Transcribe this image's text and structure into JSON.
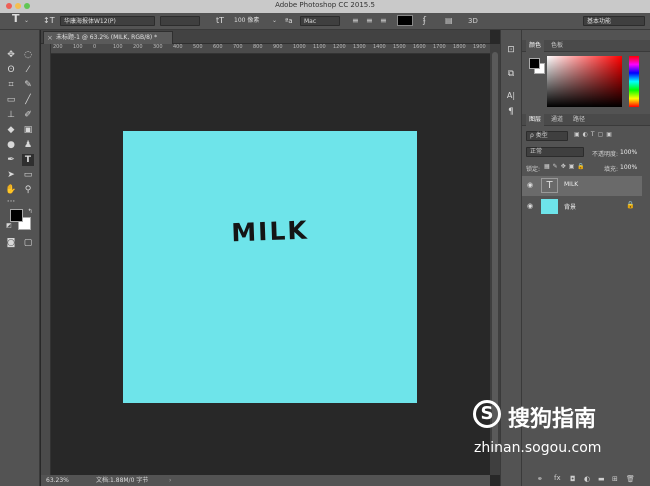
{
  "window": {
    "title": "Adobe Photoshop CC 2015.5"
  },
  "options_bar": {
    "font_family": "华康海报体W12(P)",
    "font_size": "100 像素",
    "antialias": "Mac",
    "workspace": "基本功能"
  },
  "document": {
    "tab_label": "未标题-1 @ 63.2% (MILK, RGB/8) *"
  },
  "ruler": {
    "labels": [
      "200",
      "100",
      "0",
      "100",
      "200",
      "300",
      "400",
      "500",
      "600",
      "700",
      "800",
      "900",
      "1000",
      "1100",
      "1200",
      "1300",
      "1400",
      "1500",
      "1600",
      "1700",
      "1800",
      "1900"
    ]
  },
  "canvas": {
    "text": "MILK",
    "fill_color": "#6ee4ea"
  },
  "status": {
    "zoom": "63.23%",
    "doc_info": "文档:1.88M/0 字节"
  },
  "color_panel": {
    "tabs": [
      "颜色",
      "色板"
    ]
  },
  "layers_panel": {
    "tabs": [
      "图层",
      "通道",
      "路径"
    ],
    "filter_label": "ρ 类型",
    "blend_mode": "正常",
    "opacity_label": "不透明度:",
    "opacity_value": "100%",
    "lock_label": "锁定:",
    "fill_label": "填充:",
    "fill_value": "100%",
    "layers": [
      {
        "name": "MILK",
        "type": "text"
      },
      {
        "name": "背景",
        "type": "background"
      }
    ]
  },
  "watermark": {
    "brand": "搜狗指南",
    "url": "zhinan.sogou.com"
  }
}
